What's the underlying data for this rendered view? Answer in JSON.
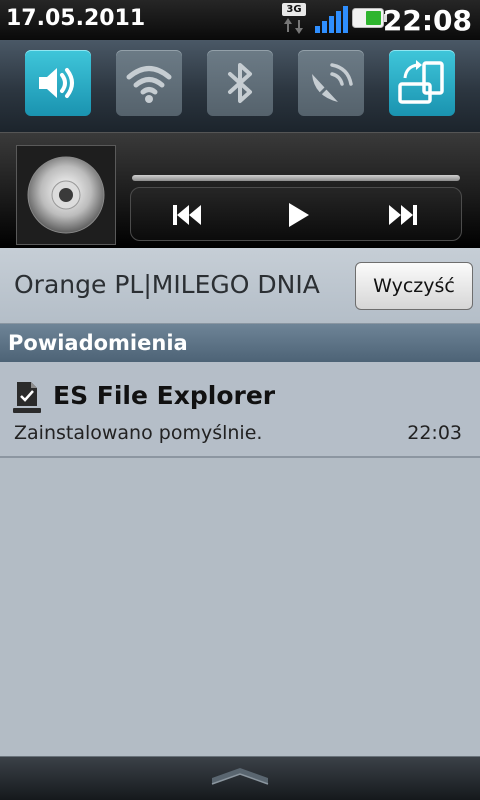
{
  "status_bar": {
    "date": "17.05.2011",
    "time": "22:08",
    "network_type": "3G",
    "signal_icon": "signal-bars-icon",
    "battery_icon": "battery-icon"
  },
  "quick_settings": [
    {
      "name": "sound",
      "icon": "speaker-icon",
      "state": "on"
    },
    {
      "name": "wifi",
      "icon": "wifi-icon",
      "state": "off"
    },
    {
      "name": "bluetooth",
      "icon": "bluetooth-icon",
      "state": "off"
    },
    {
      "name": "gps",
      "icon": "satellite-dish-icon",
      "state": "off"
    },
    {
      "name": "auto-rotate",
      "icon": "rotate-screen-icon",
      "state": "on"
    }
  ],
  "player": {
    "album_art_icon": "cd-disc-icon",
    "controls": [
      "previous-icon",
      "play-icon",
      "next-icon"
    ]
  },
  "carrier": {
    "text": "Orange PL|MILEGO DNIA",
    "clear_label": "Wyczyść"
  },
  "notifications": {
    "header": "Powiadomienia",
    "items": [
      {
        "title": "ES File Explorer",
        "description": "Zainstalowano pomyślnie.",
        "time": "22:03",
        "icon": "install-complete-icon"
      }
    ]
  },
  "colors": {
    "accent_on": "#2aa9c4",
    "toggle_off": "#606e78",
    "panel_bg": "#b3bcc5",
    "header_bg": "#5d7386"
  }
}
